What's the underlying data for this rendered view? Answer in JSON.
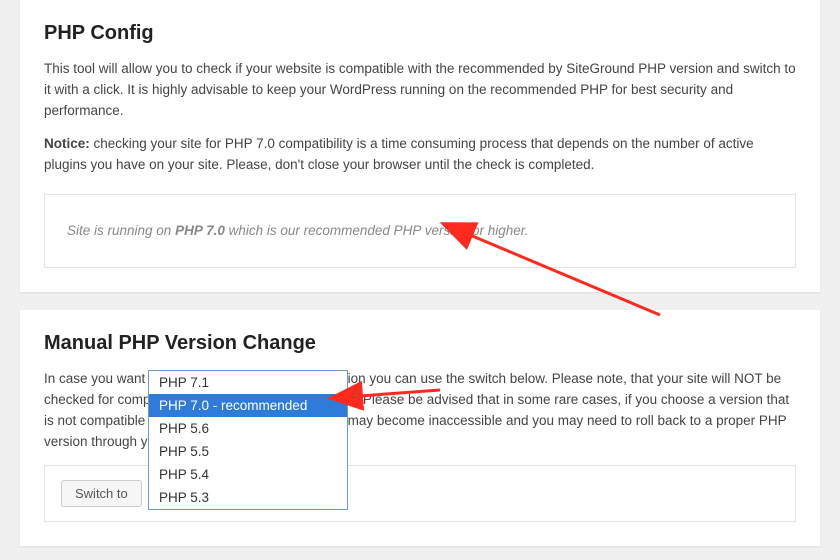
{
  "php_config": {
    "title": "PHP Config",
    "description": "This tool will allow you to check if your website is compatible with the recommended by SiteGround PHP version and switch to it with a click. It is highly advisable to keep your WordPress running on the recommended PHP for best security and performance.",
    "notice_label": "Notice:",
    "notice_text": " checking your site for PHP 7.0 compatibility is a time consuming process that depends on the number of active plugins you have on your site. Please, don't close your browser until the check is completed.",
    "status_prefix": "Site is running on ",
    "status_version": "PHP 7.0",
    "status_suffix": " which is our recommended PHP version or higher."
  },
  "manual_change": {
    "title": "Manual PHP Version Change",
    "description": "In case you want to switch to a particular PHP version you can use the switch below. Please note, that your site will NOT be checked for compatibility before the change is made. Please be advised that in some rare cases, if you choose a version that is not compatible with your WordPress your admin may become inaccessible and you may need to roll back to a proper PHP version through your .htaccess file.",
    "switch_button": "Switch to",
    "selected_value": "PHP 7.0 - recommended",
    "options": [
      "PHP 7.1",
      "PHP 7.0 - recommended",
      "PHP 5.6",
      "PHP 5.5",
      "PHP 5.4",
      "PHP 5.3"
    ]
  },
  "colors": {
    "accent_arrow": "#ff2a1f",
    "selection_bg": "#2f7bd9"
  }
}
